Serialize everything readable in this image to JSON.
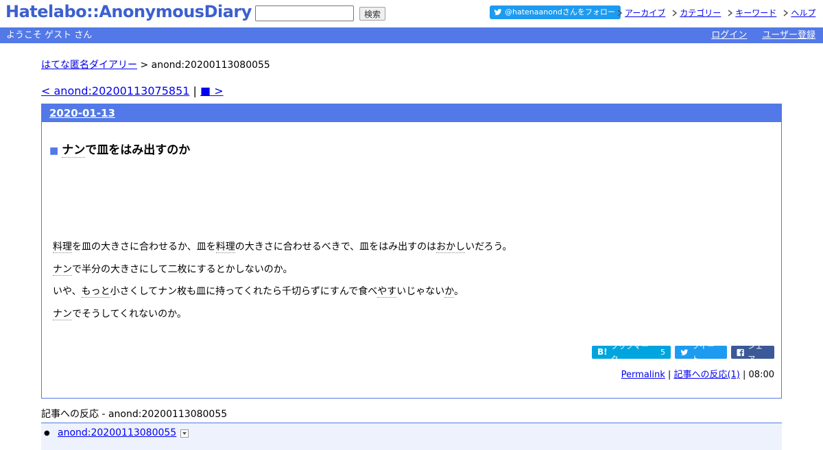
{
  "header": {
    "logo": "Hatelabo::AnonymousDiary",
    "search": {
      "value": "",
      "placeholder": ""
    },
    "search_button": "検索",
    "follow_button": "@hatenaanondさんをフォロー",
    "nav": [
      {
        "label": "アーカイブ"
      },
      {
        "label": "カテゴリー"
      },
      {
        "label": "キーワード"
      },
      {
        "label": "ヘルプ"
      }
    ]
  },
  "welcome": {
    "message": "ようこそ ゲスト さん",
    "login": "ログイン",
    "register": "ユーザー登録"
  },
  "breadcrumb": {
    "home": "はてな匿名ダイアリー",
    "separator": " > ",
    "current": "anond:20200113080055"
  },
  "pager": {
    "prev": "< anond:20200113075851",
    "separator": " | ",
    "next": "■ >"
  },
  "day": {
    "date": "2020-01-13",
    "entry": {
      "title_marker": "■",
      "title_kw": "ナン",
      "title_rest": "で皿をはみ出すのか",
      "paragraphs": {
        "p1_kw1": "料理",
        "p1_a": "を皿の大きさに合わせるか、皿を",
        "p1_kw2": "料理",
        "p1_b": "の大きさに合わせるべきで、皿をはみ出すのは",
        "p1_kw3": "おかし",
        "p1_c": "いだろう。",
        "p2_kw1": "ナン",
        "p2_a": "で半分の大きさにして二枚にするとかしないのか。",
        "p3_a": "いや、",
        "p3_kw1": "もっと",
        "p3_b": "小さくしてナン枚も皿に持ってくれたら千切らずにすんで食べ",
        "p3_kw2": "やす",
        "p3_c": "いじゃない",
        "p3_kw3": "か",
        "p3_d": "。",
        "p4_kw1": "ナン",
        "p4_a": "でそうしてくれないのか。"
      }
    },
    "share": {
      "hatena_label": "ブックマーク",
      "hatena_count": "5",
      "tweet_label": "ツイート",
      "fb_label": "シェア"
    },
    "footer": {
      "permalink": "Permalink",
      "sep1": " | ",
      "reactions_link": "記事への反応(1)",
      "sep2": " | ",
      "time": "08:00"
    }
  },
  "reactions": {
    "title": "記事への反応 - anond:20200113080055",
    "items": [
      {
        "label": "anond:20200113080055"
      }
    ]
  },
  "colors": {
    "brand": "#5279e7",
    "logo": "#3c5fd0",
    "twitter": "#1d9bf0",
    "hatena": "#00a4de",
    "facebook": "#3b5998"
  }
}
